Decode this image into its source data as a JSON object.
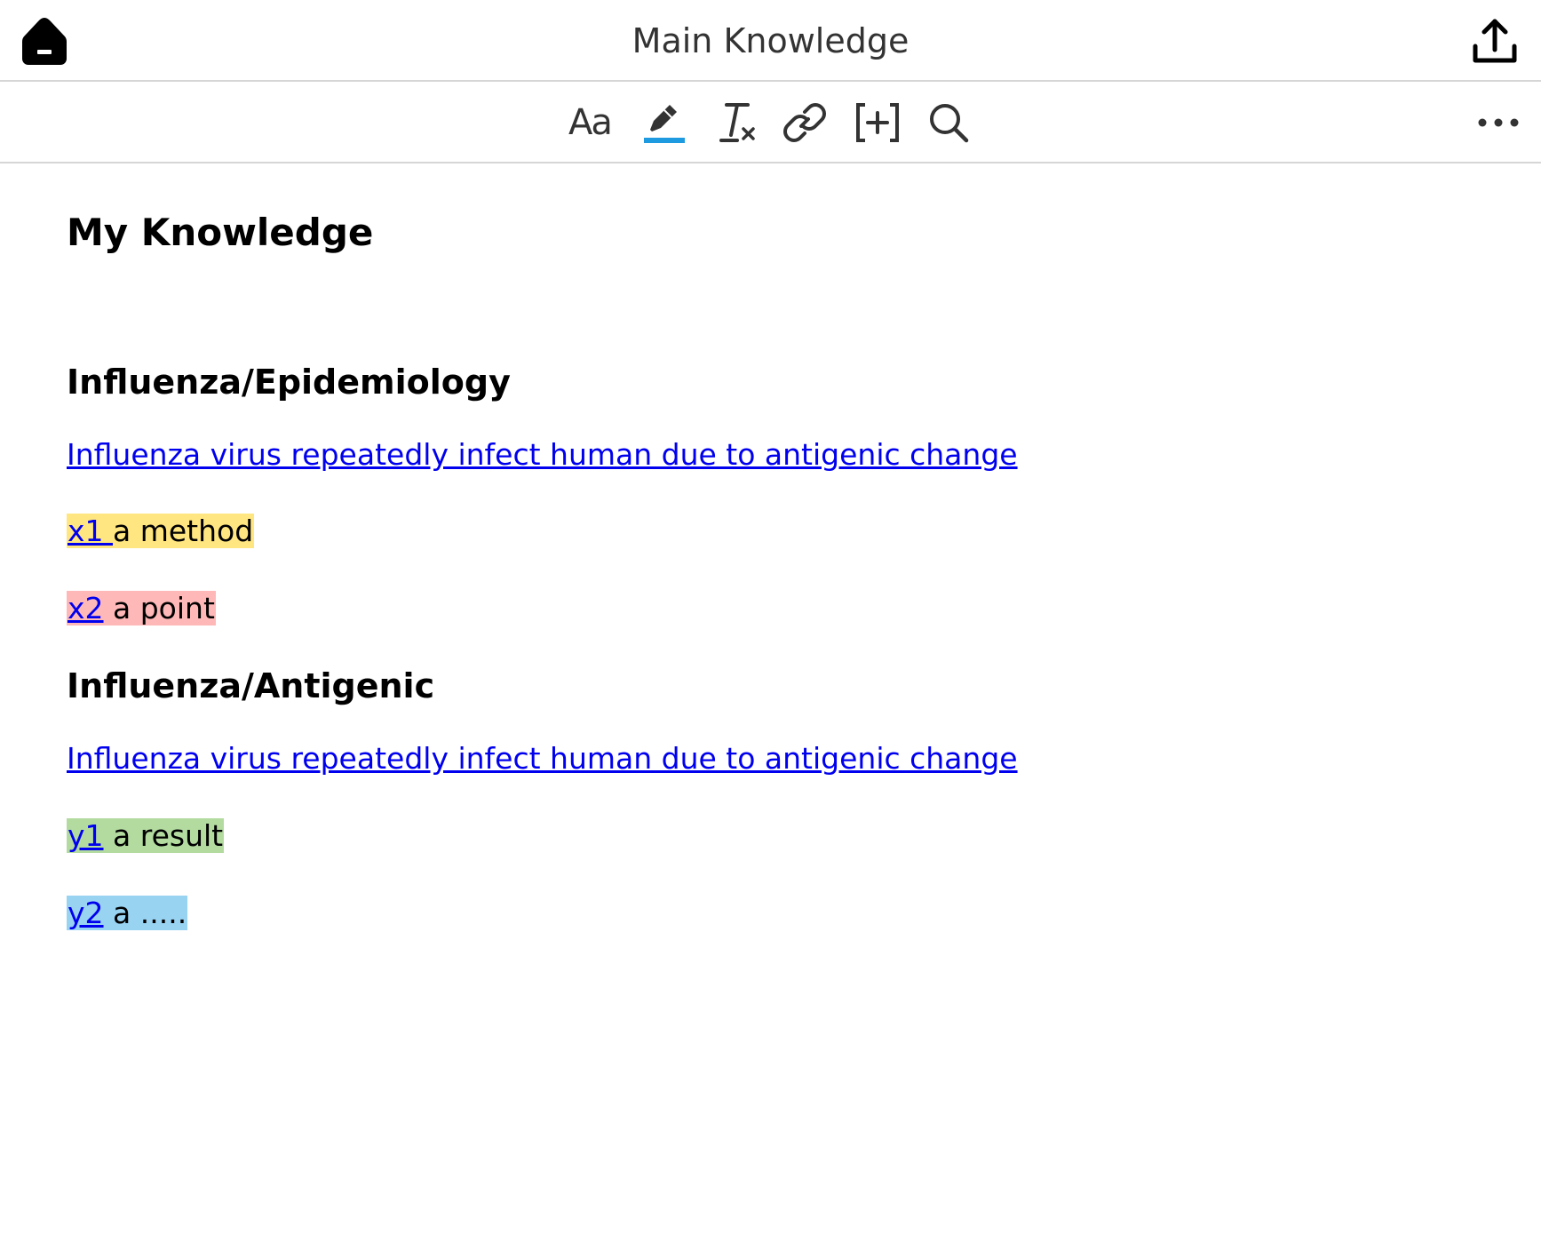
{
  "header": {
    "title": "Main Knowledge",
    "home_icon": "home-icon",
    "share_icon": "share-upload-icon"
  },
  "toolbar": {
    "font_label": "Aa",
    "tools": [
      "font-style-icon",
      "highlighter-icon",
      "clear-format-icon",
      "link-icon",
      "insert-bracket-icon",
      "search-icon",
      "more-icon"
    ],
    "highlight_color": "#1e9be0"
  },
  "document": {
    "title": "My Knowledge",
    "sections": [
      {
        "heading": "Influenza/Epidemiology",
        "link": "Influenza virus repeatedly infect human due to antigenic change",
        "items": [
          {
            "link": "x1 ",
            "text": " a method",
            "color": "#ffe680"
          },
          {
            "link": "x2",
            "text": " a point",
            "color": "#ffb8b8"
          }
        ]
      },
      {
        "heading": "Influenza/Antigenic",
        "link": "Influenza virus repeatedly infect human due to antigenic change",
        "items": [
          {
            "link": "y1",
            "text": " a result",
            "color": "#b3dba0"
          },
          {
            "link": "y2",
            "text": " a .....",
            "color": "#99d3f2"
          }
        ]
      }
    ]
  }
}
